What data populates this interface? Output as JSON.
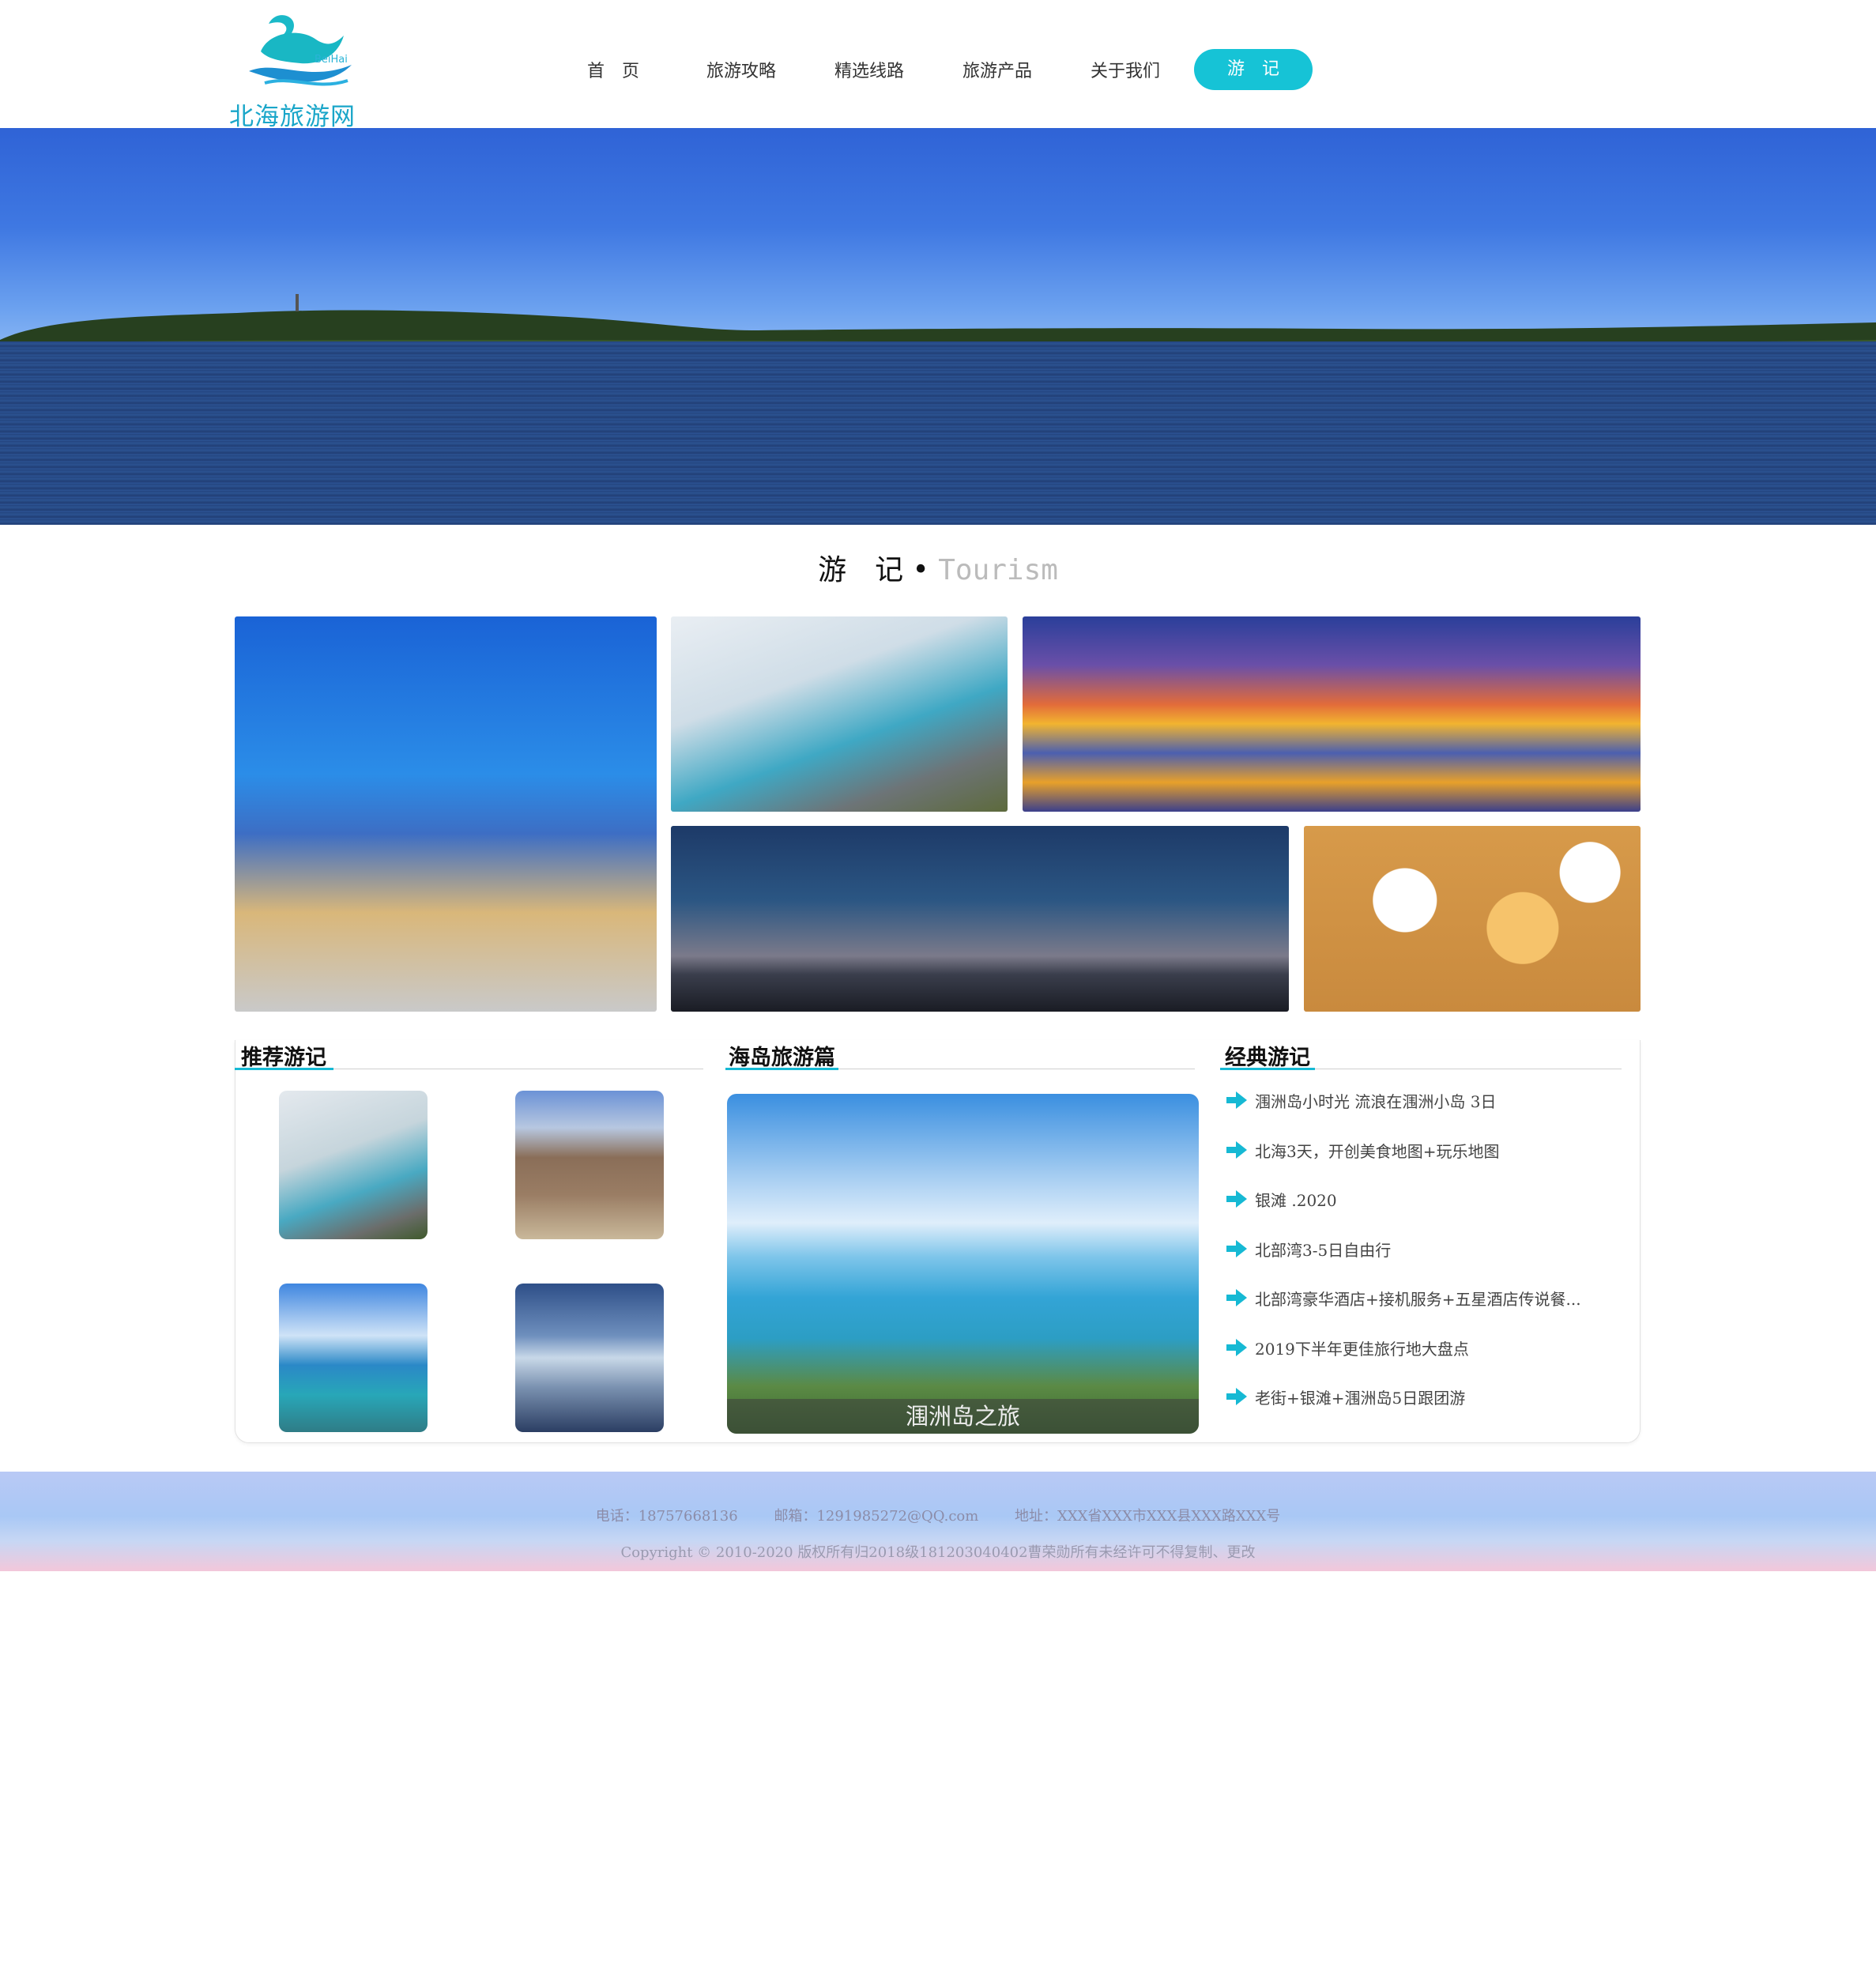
{
  "brand": {
    "name": "北海旅游网",
    "en": "BeiHai",
    "accent": "#16c3d6"
  },
  "nav": {
    "items": [
      {
        "label": "首　页",
        "active": false
      },
      {
        "label": "旅游攻略",
        "active": false
      },
      {
        "label": "精选线路",
        "active": false
      },
      {
        "label": "旅游产品",
        "active": false
      },
      {
        "label": "关于我们",
        "active": false
      },
      {
        "label": "游　记",
        "active": true
      }
    ]
  },
  "section": {
    "title": "游　记",
    "dot": "•",
    "subtitle": "Tourism"
  },
  "recommend": {
    "title": "推荐游记"
  },
  "island": {
    "title": "海岛旅游篇",
    "caption": "涠洲岛之旅"
  },
  "classic": {
    "title": "经典游记",
    "items": [
      "涠洲岛小时光 流浪在涠洲小岛 3日",
      "北海3天，开创美食地图+玩乐地图",
      "银滩 .2020",
      "北部湾3-5日自由行",
      "北部湾豪华酒店+接机服务+五星酒店传说餐...",
      "2019下半年更佳旅行地大盘点",
      "老街+银滩+涠洲岛5日跟团游"
    ]
  },
  "footer": {
    "phone": "电话：18757668136",
    "email": "邮箱：1291985272@QQ.com",
    "address": "地址：XXX省XXX市XXX县XXX路XXX号",
    "copyright": "Copyright © 2010-2020 版权所有归2018级181203040402曹荣勋所有未经许可不得复制、更改"
  }
}
